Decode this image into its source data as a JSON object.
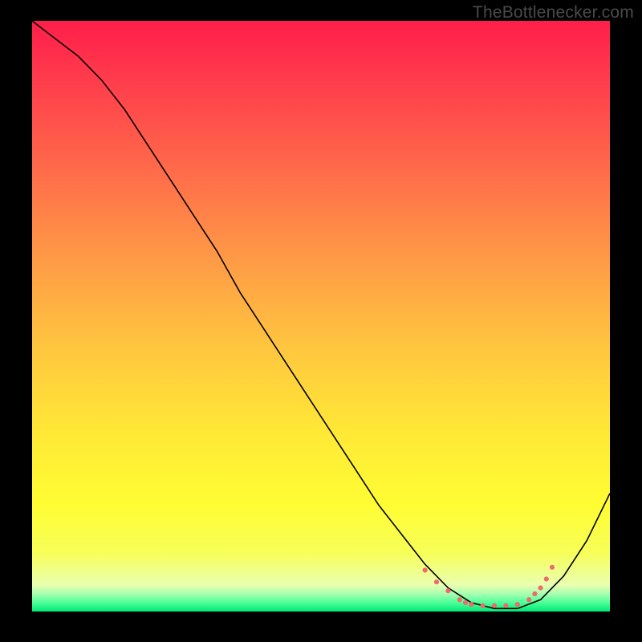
{
  "watermark": "TheBottlenecker.com",
  "chart_data": {
    "type": "line",
    "title": "",
    "xlabel": "",
    "ylabel": "",
    "xlim": [
      0,
      100
    ],
    "ylim": [
      0,
      100
    ],
    "grid": false,
    "legend": false,
    "background_gradient_stops": [
      {
        "offset": 0,
        "color": "#ff1e4a"
      },
      {
        "offset": 0.1,
        "color": "#ff3c4c"
      },
      {
        "offset": 0.25,
        "color": "#ff6a4a"
      },
      {
        "offset": 0.4,
        "color": "#ff9946"
      },
      {
        "offset": 0.55,
        "color": "#ffc53f"
      },
      {
        "offset": 0.7,
        "color": "#ffe936"
      },
      {
        "offset": 0.82,
        "color": "#fffd33"
      },
      {
        "offset": 0.9,
        "color": "#f7ff58"
      },
      {
        "offset": 0.955,
        "color": "#eaffb0"
      },
      {
        "offset": 0.97,
        "color": "#a8ffb0"
      },
      {
        "offset": 0.985,
        "color": "#4cff98"
      },
      {
        "offset": 1,
        "color": "#00e878"
      }
    ],
    "series": [
      {
        "name": "bottleneck-curve",
        "style": "solid",
        "color": "#000000",
        "width": 1.6,
        "x": [
          0,
          4,
          8,
          12,
          16,
          20,
          24,
          28,
          32,
          36,
          40,
          44,
          48,
          52,
          56,
          60,
          64,
          68,
          72,
          76,
          80,
          84,
          88,
          92,
          96,
          100
        ],
        "y": [
          100,
          97,
          94,
          90,
          85,
          79,
          73,
          67,
          61,
          54,
          48,
          42,
          36,
          30,
          24,
          18,
          13,
          8,
          4,
          1.5,
          0.5,
          0.5,
          2,
          6,
          12,
          20
        ]
      },
      {
        "name": "optimal-range-marker",
        "style": "dotted",
        "color": "#ef6a6d",
        "width": 6,
        "dot_radius": 3.1,
        "x": [
          68,
          70,
          72,
          74,
          75,
          76,
          78,
          80,
          82,
          84,
          86,
          87,
          88,
          89,
          90
        ],
        "y": [
          7,
          5,
          3.5,
          2,
          1.5,
          1.2,
          1,
          1,
          1,
          1.2,
          2,
          3,
          4,
          5.5,
          7.5
        ]
      }
    ]
  }
}
